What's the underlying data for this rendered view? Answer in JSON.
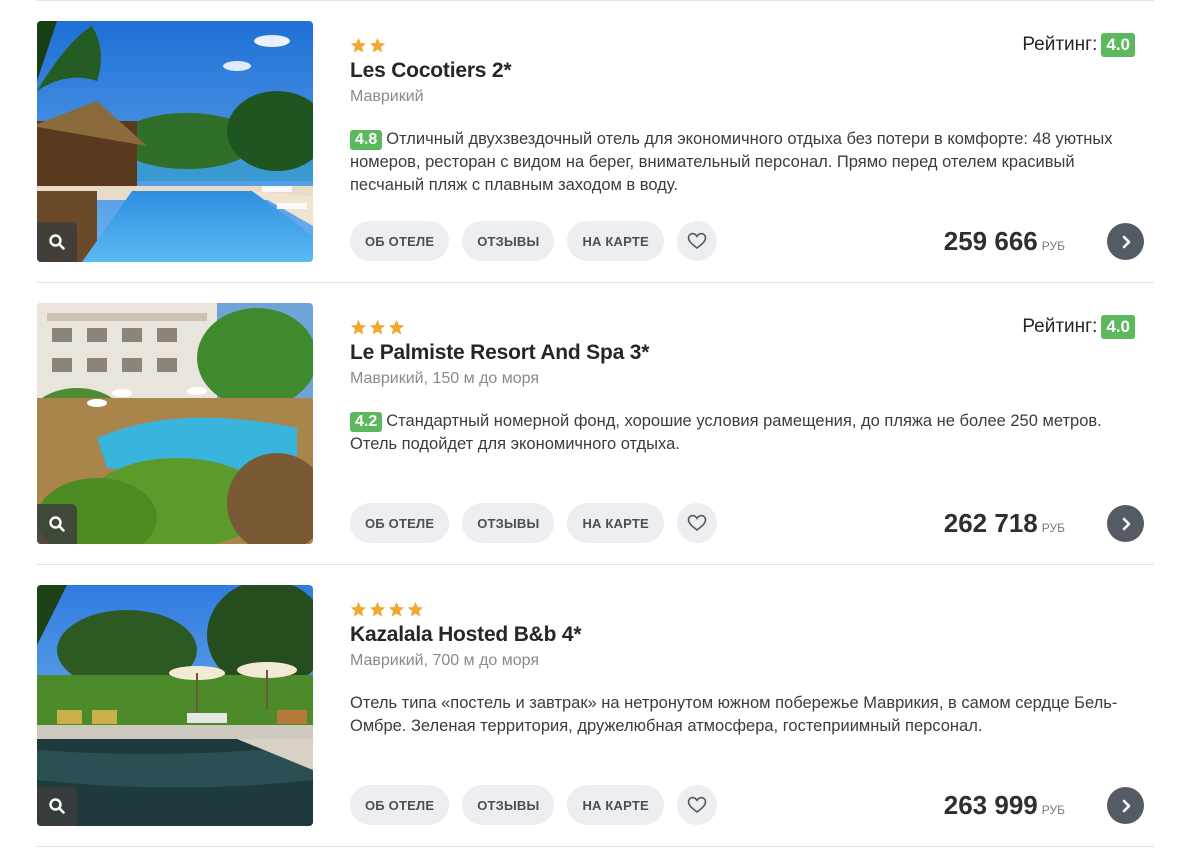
{
  "rating_label": "Рейтинг:",
  "buttons": {
    "about": "ОБ ОТЕЛЕ",
    "reviews": "ОТЗЫВЫ",
    "map": "НА КАРТЕ"
  },
  "colors": {
    "badge": "#5cb85c",
    "star": "#f0a830",
    "button_bg": "#eceef1",
    "arrow_bg": "#555b63"
  },
  "hotels": [
    {
      "stars": 2,
      "name": "Les Cocotiers 2*",
      "location": "Маврикий",
      "rating": "4.0",
      "review_score": "4.8",
      "description": "Отличный двухзвездочный отель для экономичного отдыха без потери в комфорте: 48 уютных номеров, ресторан с видом на берег, внимательный персонал. Прямо перед отелем красивый песчаный пляж с плавным заходом в воду.",
      "price": "259 666",
      "currency": "РУБ"
    },
    {
      "stars": 3,
      "name": "Le Palmiste Resort And Spa 3*",
      "location": "Маврикий, 150 м до моря",
      "rating": "4.0",
      "review_score": "4.2",
      "description": "Стандартный номерной фонд, хорошие условия рамещения, до пляжа не более 250 метров. Отель подойдет для экономичного отдыха.",
      "price": "262 718",
      "currency": "РУБ"
    },
    {
      "stars": 4,
      "name": "Kazalala Hosted B&b 4*",
      "location": "Маврикий, 700 м до моря",
      "rating": "",
      "review_score": "",
      "description": "Отель типа «постель и завтрак» на нетронутом южном побережье Маврикия, в самом сердце Бель-Омбре. Зеленая территория, дружелюбная атмосфера, гостеприимный персонал.",
      "price": "263 999",
      "currency": "РУБ"
    }
  ]
}
